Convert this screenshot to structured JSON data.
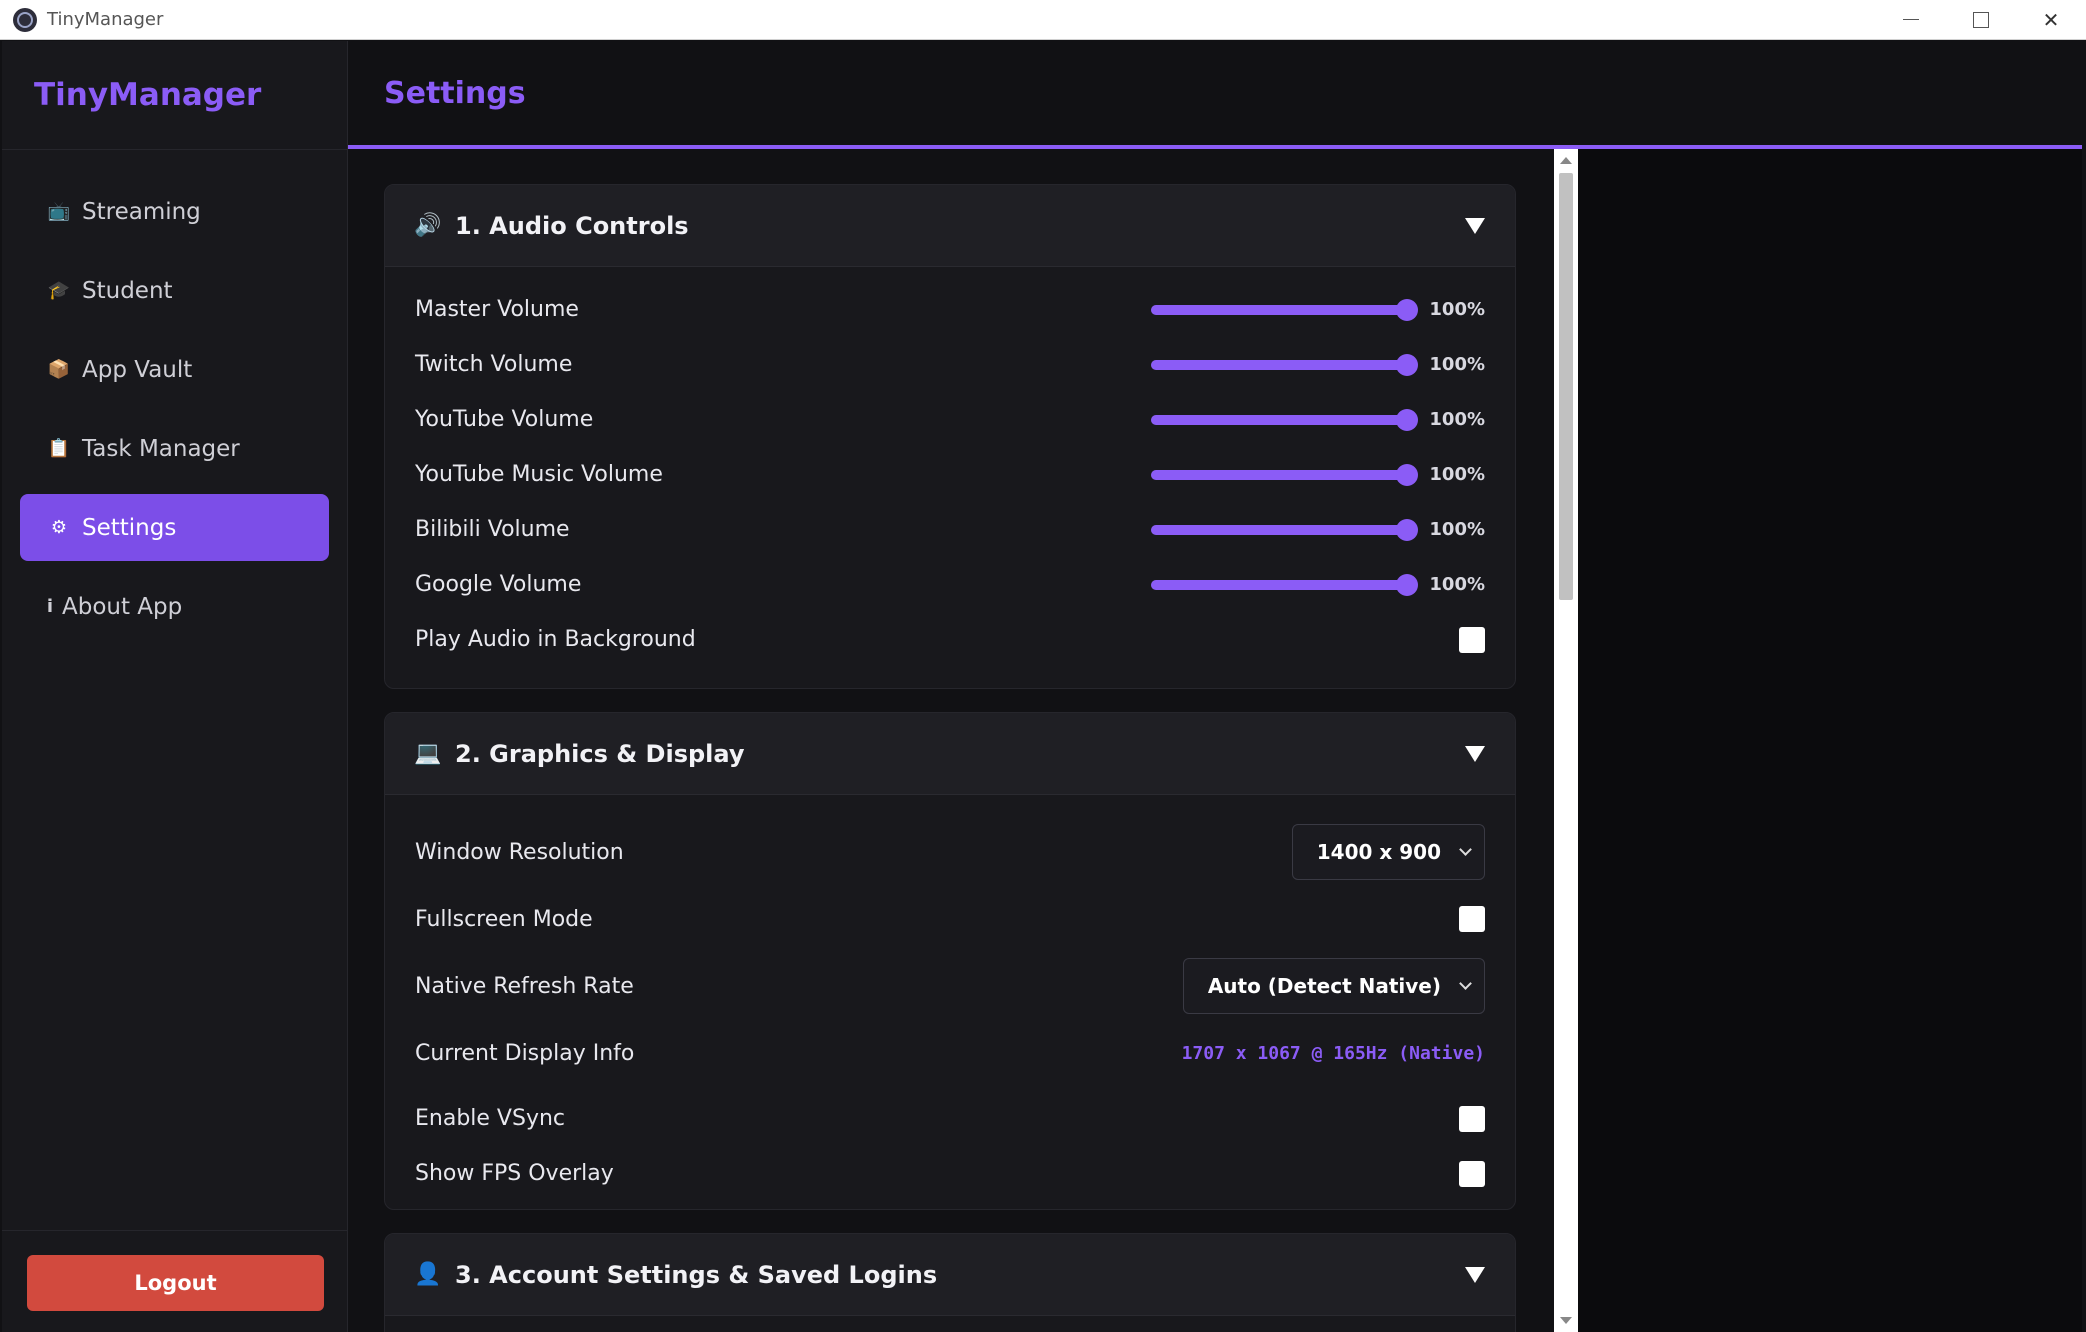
{
  "window": {
    "title": "TinyManager",
    "close_glyph": "✕"
  },
  "sidebar": {
    "brand": "TinyManager",
    "items": [
      {
        "label": "Streaming",
        "icon": "monitor-icon",
        "glyph": "📺"
      },
      {
        "label": "Student",
        "icon": "graduation-cap-icon",
        "glyph": "🎓"
      },
      {
        "label": "App Vault",
        "icon": "package-icon",
        "glyph": "📦"
      },
      {
        "label": "Task Manager",
        "icon": "clipboard-icon",
        "glyph": "📋"
      },
      {
        "label": "Settings",
        "icon": "gear-icon",
        "glyph": "⚙",
        "active": true
      },
      {
        "label": "About App",
        "icon": "info-icon",
        "glyph": "i"
      }
    ],
    "logout_label": "Logout"
  },
  "header": {
    "title": "Settings"
  },
  "sections": {
    "audio": {
      "title": "1. Audio Controls",
      "icon": "speaker-icon",
      "glyph": "🔊",
      "sliders": [
        {
          "label": "Master Volume",
          "value": 100,
          "display": "100%"
        },
        {
          "label": "Twitch Volume",
          "value": 100,
          "display": "100%"
        },
        {
          "label": "YouTube Volume",
          "value": 100,
          "display": "100%"
        },
        {
          "label": "YouTube Music Volume",
          "value": 100,
          "display": "100%"
        },
        {
          "label": "Bilibili Volume",
          "value": 100,
          "display": "100%"
        },
        {
          "label": "Google Volume",
          "value": 100,
          "display": "100%"
        }
      ],
      "background_label": "Play Audio in Background",
      "background_checked": false
    },
    "graphics": {
      "title": "2. Graphics & Display",
      "icon": "computer-icon",
      "glyph": "💻",
      "resolution_label": "Window Resolution",
      "resolution_value": "1400 x 900",
      "fullscreen_label": "Fullscreen Mode",
      "fullscreen_checked": false,
      "refresh_label": "Native Refresh Rate",
      "refresh_value": "Auto (Detect Native)",
      "display_info_label": "Current Display Info",
      "display_info_value": "1707 x 1067 @ 165Hz (Native)",
      "vsync_label": "Enable VSync",
      "vsync_checked": false,
      "fps_label": "Show FPS Overlay",
      "fps_checked": false
    },
    "account": {
      "title": "3. Account Settings & Saved Logins",
      "icon": "user-icon",
      "glyph": "👤"
    }
  },
  "colors": {
    "accent": "#8b5cf6",
    "active_nav": "#7c4ee8",
    "logout": "#d24a3e"
  }
}
